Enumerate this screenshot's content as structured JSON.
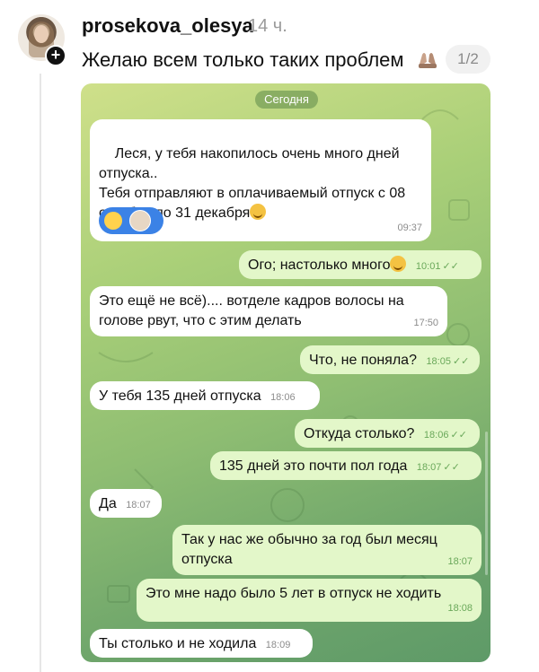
{
  "post": {
    "username": "prosekova_olesya",
    "time_ago": "14 ч.",
    "caption": "Желаю всем только таких проблем",
    "page_counter": "1/2"
  },
  "chat": {
    "date_label": "Сегодня",
    "messages": [
      {
        "dir": "in",
        "text": "Леся, у тебя накопилось очень много дней отпуска..\nТебя отправляют в оплачиваемый отпуск с 08 октября по 31 декабря",
        "time": "09:37"
      },
      {
        "dir": "out",
        "text": "Ого; настолько много",
        "time": "10:01"
      },
      {
        "dir": "in",
        "text": "Это ещё не всё).... вотделе кадров волосы на голове рвут, что с этим делать",
        "time": "17:50"
      },
      {
        "dir": "out",
        "text": "Что, не поняла?",
        "time": "18:05"
      },
      {
        "dir": "in",
        "text": "У тебя 135 дней отпуска",
        "time": "18:06"
      },
      {
        "dir": "out",
        "text": "Откуда столько?",
        "time": "18:06"
      },
      {
        "dir": "out",
        "text": "135 дней это почти пол года",
        "time": "18:07"
      },
      {
        "dir": "in",
        "text": "Да",
        "time": "18:07"
      },
      {
        "dir": "out",
        "text": "Так у нас же обычно за год был месяц отпуска",
        "time": "18:07"
      },
      {
        "dir": "out",
        "text": "Это мне надо было 5 лет в отпуск не ходить",
        "time": "18:08"
      },
      {
        "dir": "in",
        "text": "Ты столько и не ходила",
        "time": "18:09"
      }
    ],
    "check_mark": "✓✓"
  },
  "icons": {
    "plus": "+",
    "hands": "praying-hands-icon"
  }
}
